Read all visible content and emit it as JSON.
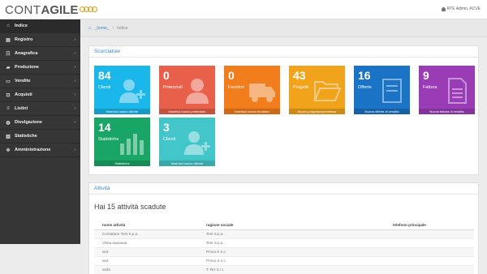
{
  "header": {
    "logo_prefix": "CONT",
    "logo_bold": "AGILE",
    "user_name": "RTE Admin, ACVE"
  },
  "sidebar": {
    "items": [
      {
        "label": "Indice",
        "icon": "home-icon",
        "glyph": "⌂",
        "active": true,
        "chevron": false
      },
      {
        "label": "Registro",
        "icon": "book-icon",
        "glyph": "▤",
        "active": false,
        "chevron": true
      },
      {
        "label": "Anagrafica",
        "icon": "users-icon",
        "glyph": "☷",
        "active": false,
        "chevron": true
      },
      {
        "label": "Produzione",
        "icon": "folder-icon",
        "glyph": "▰",
        "active": false,
        "chevron": true
      },
      {
        "label": "Vendite",
        "icon": "money-icon",
        "glyph": "▭",
        "active": false,
        "chevron": true
      },
      {
        "label": "Acquisti",
        "icon": "cart-icon",
        "glyph": "⊡",
        "active": false,
        "chevron": true
      },
      {
        "label": "Listini",
        "icon": "list-icon",
        "glyph": "≡",
        "active": false,
        "chevron": true
      },
      {
        "label": "Divulgazione",
        "icon": "globe-icon",
        "glyph": "◍",
        "active": false,
        "chevron": true
      },
      {
        "label": "Statistiche",
        "icon": "bar-chart-icon",
        "glyph": "▥",
        "active": false,
        "chevron": false
      },
      {
        "label": "Amministrazione",
        "icon": "gear-icon",
        "glyph": "✲",
        "active": false,
        "chevron": true
      }
    ]
  },
  "breadcrumb": {
    "home": "_home_",
    "current": "Indice"
  },
  "shortcuts": {
    "title": "Scorciatoie",
    "tiles": [
      {
        "count": "84",
        "label": "Clienti",
        "footer": "Inserisci nuovo cliente",
        "color": "#1ab7ea",
        "icon": "add-user-icon"
      },
      {
        "count": "0",
        "label": "Potenziali",
        "footer": "Inserisci nuovo potenziale",
        "color": "#e8604a",
        "icon": "user-icon"
      },
      {
        "count": "0",
        "label": "Fornitori",
        "footer": "Inserisci nuovo fornitore",
        "color": "#f27d1c",
        "icon": "truck-icon"
      },
      {
        "count": "43",
        "label": "Progetti",
        "footer": "Nuovo progetto/commessa",
        "color": "#f2a31c",
        "icon": "folder-open-icon"
      },
      {
        "count": "16",
        "label": "Offerte",
        "footer": "Nuova offerta di vendita",
        "color": "#1a73c4",
        "icon": "offer-icon"
      },
      {
        "count": "9",
        "label": "Fattura",
        "footer": "Nuova fattura di vendita",
        "color": "#9b3cb7",
        "icon": "invoice-icon"
      },
      {
        "count": "14",
        "label": "Statistiche",
        "footer": "Statistiche",
        "color": "#19a566",
        "icon": "bar-chart-icon"
      },
      {
        "count": "3",
        "label": "Clienti",
        "footer": "Inserisci nuovo cliente",
        "color": "#43c6c9",
        "icon": "add-user-icon"
      }
    ]
  },
  "activities": {
    "title": "Attività",
    "heading": "Hai 15 attività scadute",
    "columns": [
      "nome attività",
      "ragione sociale",
      "telefono principale"
    ],
    "rows": [
      [
        "Contattare Test S.p.a.",
        "Test S.p.a.",
        ""
      ],
      [
        "Visita aaaaaaa",
        "Test S.p.a.",
        ""
      ],
      [
        "asd",
        "Prova S.n.c.",
        ""
      ],
      [
        "asd",
        "Prova S.n.c.",
        ""
      ],
      [
        "asda",
        "T. RH S.r.l.",
        ""
      ]
    ]
  }
}
